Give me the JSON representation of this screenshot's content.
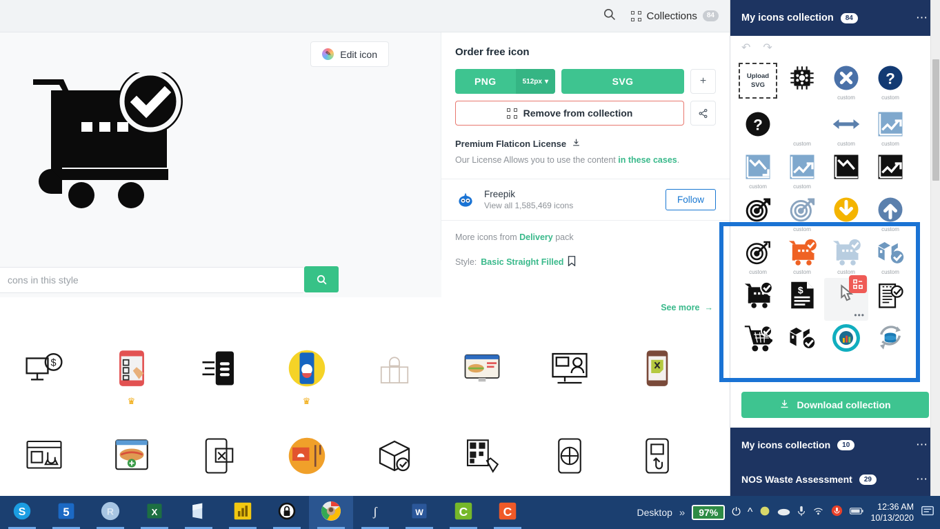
{
  "topbar": {
    "search_icon": "search-icon",
    "collections_label": "Collections",
    "collections_count": "84"
  },
  "detail": {
    "edit_icon_label": "Edit icon",
    "preview_icon_name": "shopping-cart-check-icon",
    "search_placeholder": "cons in this style",
    "search_button_icon": "search-icon"
  },
  "order": {
    "title": "Order free icon",
    "png_label": "PNG",
    "png_size": "512px",
    "svg_label": "SVG",
    "add_label": "+",
    "remove_label": "Remove from collection",
    "share_icon": "share-icon",
    "license_label": "Premium Flaticon License",
    "license_download_icon": "download-icon",
    "license_note_prefix": "Our License Allows you to use the content ",
    "license_note_link": "in these cases",
    "license_note_suffix": "."
  },
  "author": {
    "name": "Freepik",
    "subtitle": "View all 1,585,469 icons",
    "follow_label": "Follow"
  },
  "pack": {
    "more_prefix": "More icons from ",
    "more_link": "Delivery",
    "more_suffix": " pack",
    "style_prefix": "Style: ",
    "style_value": "Basic Straight Filled",
    "bookmark_icon": "bookmark-icon"
  },
  "related": {
    "see_more_label": "See more",
    "rows": [
      [
        {
          "name": "chat-money-monitor-icon",
          "premium": false
        },
        {
          "name": "mobile-checklist-hand-icon",
          "premium": true
        },
        {
          "name": "mobile-burger-lines-icon",
          "premium": false
        },
        {
          "name": "mobile-food-delivery-icon",
          "premium": true
        },
        {
          "name": "shopping-bag-shelf-icon",
          "premium": false
        },
        {
          "name": "food-order-website-icon",
          "premium": false
        },
        {
          "name": "monitor-chat-person-icon",
          "premium": false
        },
        {
          "name": "mobile-restaurant-chat-icon",
          "premium": false
        }
      ],
      [
        {
          "name": "browser-package-click-icon",
          "premium": false
        },
        {
          "name": "hotdog-add-browser-icon",
          "premium": false
        },
        {
          "name": "mobile-cutlery-chat-icon",
          "premium": false
        },
        {
          "name": "food-tray-fork-icon",
          "premium": false
        },
        {
          "name": "package-check-box-icon",
          "premium": false
        },
        {
          "name": "mobile-qr-scan-icon",
          "premium": false
        },
        {
          "name": "mobile-gift-target-icon",
          "premium": false
        },
        {
          "name": "mobile-hand-tap-icon",
          "premium": false
        }
      ]
    ]
  },
  "panel": {
    "title": "My icons collection",
    "count": "84",
    "menu_icon": "ellipsis-icon",
    "undo_icon": "undo-icon",
    "redo_icon": "redo-icon",
    "upload_line1": "Upload",
    "upload_line2": "SVG",
    "custom_label": "custom",
    "download_collection_label": "Download collection",
    "download_icon": "download-icon",
    "grid": [
      [
        {
          "name": "upload-svg-dropzone",
          "label": ""
        },
        {
          "name": "cpu-chip-icon",
          "label": ""
        },
        {
          "name": "blue-x-circle-icon",
          "label": "custom"
        },
        {
          "name": "navy-question-circle-icon",
          "label": "custom"
        }
      ],
      [
        {
          "name": "black-question-circle-icon",
          "label": ""
        },
        {
          "name": "empty-slot",
          "label": "custom"
        },
        {
          "name": "double-arrow-icon",
          "label": "custom"
        },
        {
          "name": "chart-up-blue-icon",
          "label": "custom"
        }
      ],
      [
        {
          "name": "chart-down-blue-icon",
          "label": "custom"
        },
        {
          "name": "chart-up-blue-2-icon",
          "label": "custom"
        },
        {
          "name": "chart-down-black-icon",
          "label": ""
        },
        {
          "name": "chart-up-black-icon",
          "label": ""
        }
      ],
      [
        {
          "name": "target-dart-black-icon",
          "label": ""
        },
        {
          "name": "target-dart-grey-icon",
          "label": "custom"
        },
        {
          "name": "download-circle-yellow-icon",
          "label": ""
        },
        {
          "name": "upload-circle-blue-icon",
          "label": "custom"
        }
      ],
      [
        {
          "name": "target-dart-outline-icon",
          "label": "custom"
        },
        {
          "name": "cart-check-orange-icon",
          "label": "custom"
        },
        {
          "name": "cart-check-light-icon",
          "label": "custom"
        },
        {
          "name": "package-check-blue-icon",
          "label": "custom"
        }
      ],
      [
        {
          "name": "cart-check-black-icon",
          "label": ""
        },
        {
          "name": "invoice-dollar-icon",
          "label": ""
        },
        {
          "name": "hovered-icon-cell",
          "label": ""
        },
        {
          "name": "document-check-icon",
          "label": ""
        }
      ],
      [
        {
          "name": "cart-basket-check-icon",
          "label": ""
        },
        {
          "name": "package-check-black-icon",
          "label": ""
        },
        {
          "name": "analytics-circle-teal-icon",
          "label": ""
        },
        {
          "name": "database-sync-icon",
          "label": ""
        }
      ]
    ],
    "collections": [
      {
        "title": "My icons collection",
        "count": "10",
        "menu_icon": "ellipsis-icon"
      },
      {
        "title": "NOS Waste Assessment",
        "count": "29",
        "menu_icon": "ellipsis-icon"
      }
    ]
  },
  "taskbar": {
    "apps": [
      {
        "name": "skype-taskbar-icon",
        "letter": "S",
        "active": false,
        "open": true
      },
      {
        "name": "snagit-taskbar-icon",
        "letter": "S",
        "active": false,
        "open": true
      },
      {
        "name": "rstudio-taskbar-icon",
        "letter": "R",
        "active": false,
        "open": true
      },
      {
        "name": "excel-taskbar-icon",
        "letter": "X",
        "active": false,
        "open": true
      },
      {
        "name": "onenote-taskbar-icon",
        "letter": "N",
        "active": false,
        "open": true
      },
      {
        "name": "powerbi-taskbar-icon",
        "letter": "",
        "active": false,
        "open": true
      },
      {
        "name": "lastpass-taskbar-icon",
        "letter": "",
        "active": false,
        "open": true
      },
      {
        "name": "chrome-taskbar-icon",
        "letter": "",
        "active": true,
        "open": true
      },
      {
        "name": "gotomeeting-taskbar-icon",
        "letter": "",
        "active": false,
        "open": true
      },
      {
        "name": "word-taskbar-icon",
        "letter": "W",
        "active": false,
        "open": true
      },
      {
        "name": "camtasia-taskbar-icon",
        "letter": "C",
        "active": false,
        "open": true
      },
      {
        "name": "camtasia-recorder-taskbar-icon",
        "letter": "C",
        "active": false,
        "open": true
      }
    ],
    "desktop_label": "Desktop",
    "overflow_label": "»",
    "battery_label": "97%",
    "time": "12:36 AM",
    "date": "10/13/2020",
    "tray_icons": [
      "power-plug-icon",
      "chevron-up-icon",
      "shield-icon",
      "cloud-icon",
      "microphone-icon",
      "wifi-icon",
      "record-icon",
      "battery-tray-icon"
    ],
    "action_center_icon": "action-center-icon"
  },
  "colors": {
    "navy": "#1d3461",
    "green": "#3ec490",
    "highlight_blue": "#1a73d4",
    "remove_red": "#e8776e",
    "taskbar": "#1b3f70"
  }
}
